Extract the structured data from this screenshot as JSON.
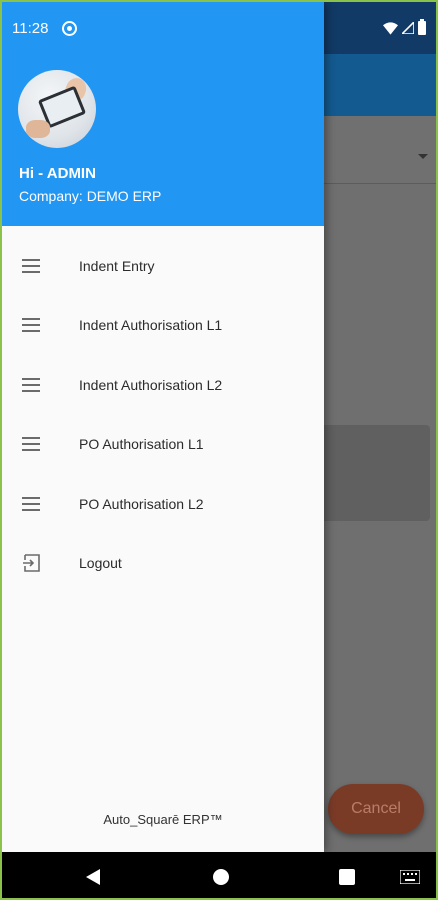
{
  "status_bar": {
    "time": "11:28"
  },
  "drawer": {
    "greeting": "Hi - ADMIN",
    "company": "Company: DEMO ERP",
    "items": [
      {
        "label": "Indent Entry",
        "icon": "menu-lines-icon"
      },
      {
        "label": "Indent Authorisation L1",
        "icon": "menu-lines-icon"
      },
      {
        "label": "Indent Authorisation L2",
        "icon": "menu-lines-icon"
      },
      {
        "label": "PO Authorisation L1",
        "icon": "menu-lines-icon"
      },
      {
        "label": "PO Authorisation L2",
        "icon": "menu-lines-icon"
      },
      {
        "label": "Logout",
        "icon": "logout-icon"
      }
    ],
    "footer": "Auto_Squarē ERP™"
  },
  "background": {
    "cancel_label": "Cancel"
  },
  "colors": {
    "header_blue": "#2196f3",
    "status_bar": "#113a66",
    "toolbar": "#135a91",
    "cancel_button": "#7a3b26"
  }
}
